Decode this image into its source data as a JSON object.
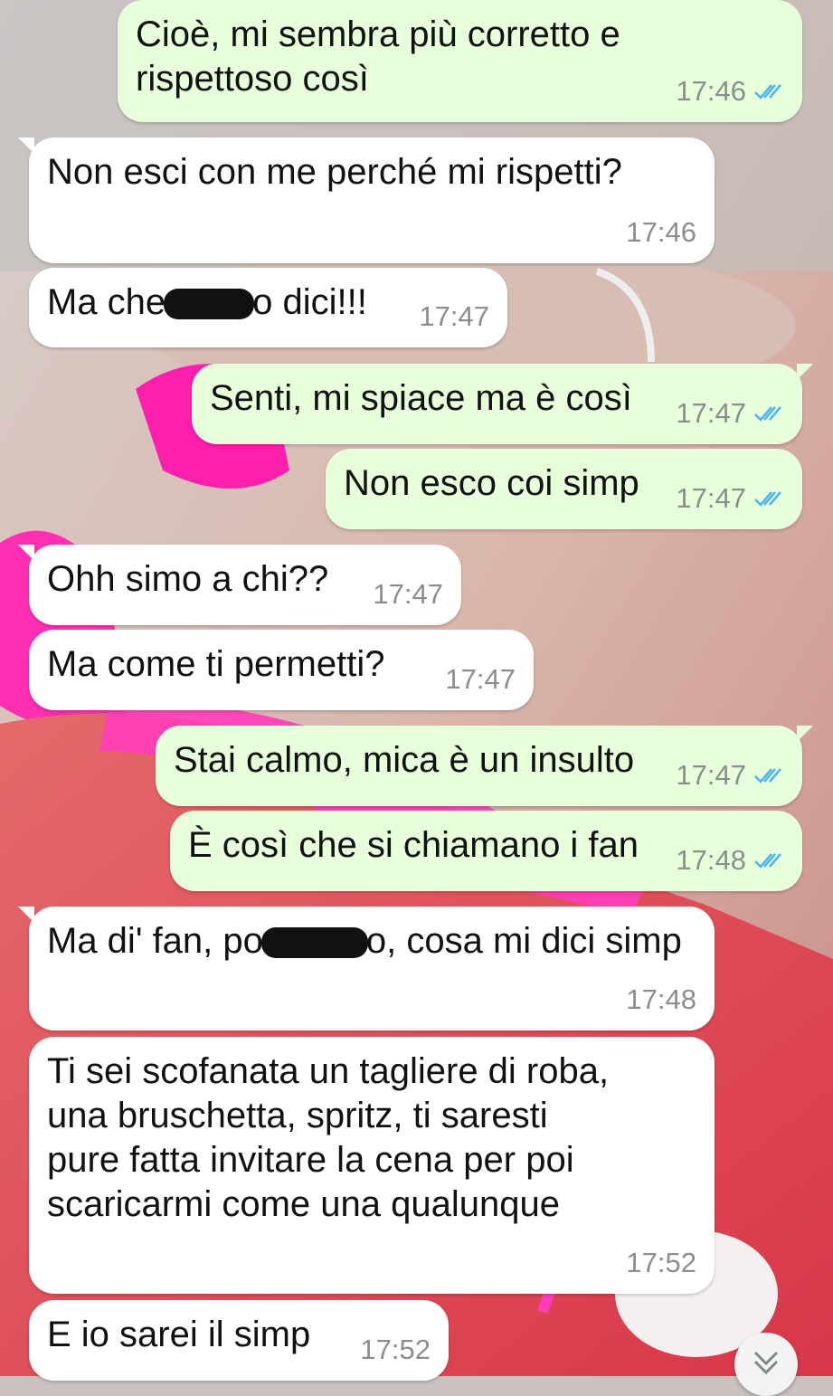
{
  "colors": {
    "incoming_bubble": "#ffffff",
    "outgoing_bubble": "#e7ffdb",
    "timestamp": "#8a8f8c",
    "read_ticks": "#4fb6ec"
  },
  "messages": [
    {
      "direction": "out",
      "lines": [
        "Cioè, mi sembra più corretto e",
        "rispettoso così"
      ],
      "time": "17:46",
      "status": "read"
    },
    {
      "direction": "in",
      "lines": [
        "Non esci con me perché mi rispetti?"
      ],
      "time": "17:46"
    },
    {
      "direction": "in",
      "text_before": "Ma che",
      "text_after": "o dici!!!",
      "censored": true,
      "time": "17:47"
    },
    {
      "direction": "out",
      "lines": [
        "Senti, mi spiace ma è così"
      ],
      "time": "17:47",
      "status": "read"
    },
    {
      "direction": "out",
      "lines": [
        "Non esco coi simp"
      ],
      "time": "17:47",
      "status": "read"
    },
    {
      "direction": "in",
      "lines": [
        "Ohh simo a chi??"
      ],
      "time": "17:47"
    },
    {
      "direction": "in",
      "lines": [
        "Ma come ti permetti?"
      ],
      "time": "17:47"
    },
    {
      "direction": "out",
      "lines": [
        "Stai calmo, mica è un insulto"
      ],
      "time": "17:47",
      "status": "read"
    },
    {
      "direction": "out",
      "lines": [
        "È così che si chiamano i fan"
      ],
      "time": "17:48",
      "status": "read"
    },
    {
      "direction": "in",
      "text_before": "Ma di' fan, po",
      "text_after": "o, cosa mi dici simp",
      "censored": true,
      "time": "17:48"
    },
    {
      "direction": "in",
      "lines": [
        "Ti sei scofanata un tagliere di roba,",
        "una bruschetta, spritz, ti saresti",
        "pure fatta invitare la cena per poi",
        "scaricarmi come una qualunque"
      ],
      "time": "17:52"
    },
    {
      "direction": "in",
      "lines": [
        "E io sarei il simp"
      ],
      "time": "17:52"
    }
  ],
  "scroll_button": {
    "icon": "double-chevron-down-icon"
  }
}
